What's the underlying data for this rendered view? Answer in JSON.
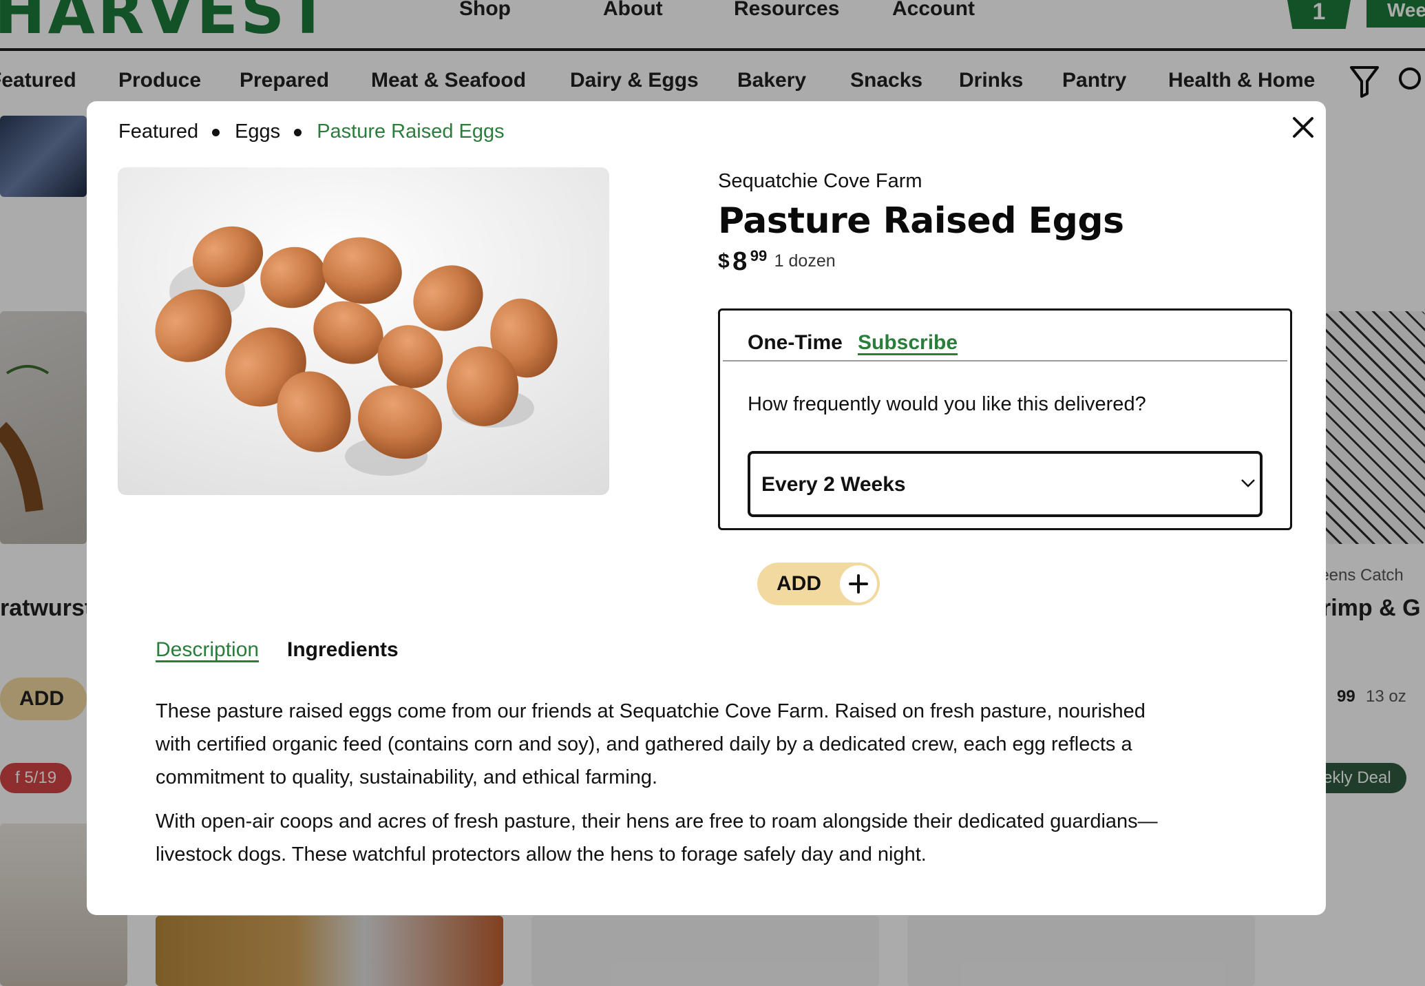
{
  "background": {
    "logo": "HARVEST",
    "top_nav": [
      "Shop",
      "About",
      "Resources",
      "Account"
    ],
    "cart_count": "1",
    "week_button": "Wee",
    "categories": [
      "Featured",
      "Produce",
      "Prepared",
      "Meat & Seafood",
      "Dairy & Eggs",
      "Bakery",
      "Snacks",
      "Drinks",
      "Pantry",
      "Health & Home"
    ],
    "cards": {
      "left_title": "ratwurst",
      "left_add": "ADD",
      "left_badge": "f 5/19",
      "right_vendor": "leens Catch",
      "right_title": "rimp & G",
      "right_price_cents": "99",
      "right_unit": "13 oz",
      "right_badge": "ekly Deal"
    }
  },
  "modal": {
    "breadcrumbs": [
      "Featured",
      "Eggs",
      "Pasture Raised Eggs"
    ],
    "vendor": "Sequatchie Cove Farm",
    "title": "Pasture Raised Eggs",
    "price": {
      "currency": "$",
      "dollars": "8",
      "cents": "99",
      "unit": "1 dozen"
    },
    "purchase": {
      "tabs": [
        "One-Time",
        "Subscribe"
      ],
      "active_tab": "Subscribe",
      "frequency_question": "How frequently would you like this delivered?",
      "frequency_selected": "Every 2 Weeks"
    },
    "add_button": "ADD",
    "detail_tabs": [
      "Description",
      "Ingredients"
    ],
    "active_detail_tab": "Description",
    "description": [
      "These pasture raised eggs come from our friends at Sequatchie Cove Farm. Raised on fresh pasture, nourished with certified organic feed (contains corn and soy), and gathered daily by a dedicated crew, each egg reflects a commitment to quality, sustainability, and ethical farming.",
      "With open-air coops and acres of fresh pasture, their hens are free to roam alongside their dedicated guardians—livestock dogs. These watchful protectors allow the hens to forage safely day and night."
    ]
  },
  "colors": {
    "brand_green": "#1d7a3a",
    "link_green": "#2a7d3b",
    "add_button": "#f2d9a0"
  },
  "icons": [
    "close-icon",
    "filter-icon",
    "search-icon",
    "chevron-down-icon",
    "plus-icon"
  ]
}
